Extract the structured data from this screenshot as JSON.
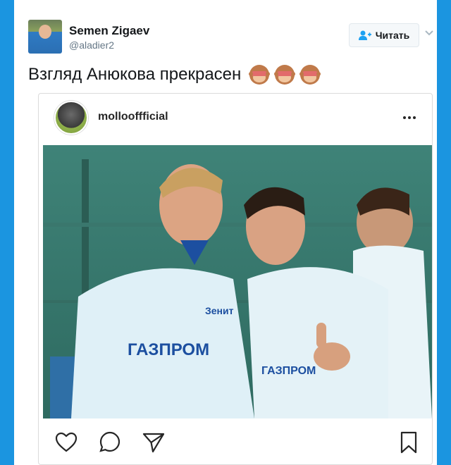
{
  "tweet": {
    "user_name": "Semen Zigaev",
    "user_handle": "@aladier2",
    "follow_label": "Читать",
    "text": "Взгляд Анюкова прекрасен"
  },
  "instagram": {
    "username": "mollooffficial",
    "photo_texts": {
      "sponsor_left": "ГАЗПРОМ",
      "club_logo": "Зенит",
      "sponsor_right": "ГАЗПРОМ"
    }
  },
  "icons": {
    "follow": "add-user-icon",
    "menu": "chevron-down-icon",
    "emoji": "see-no-evil-monkey-icon",
    "more": "more-horizontal-icon",
    "like": "heart-icon",
    "comment": "comment-icon",
    "share": "send-icon",
    "save": "bookmark-icon"
  },
  "colors": {
    "twitter_blue": "#1da1f2",
    "text": "#14171a",
    "muted": "#657786",
    "zenit_blue": "#1c4fa0",
    "shirt": "#dff0f7"
  }
}
